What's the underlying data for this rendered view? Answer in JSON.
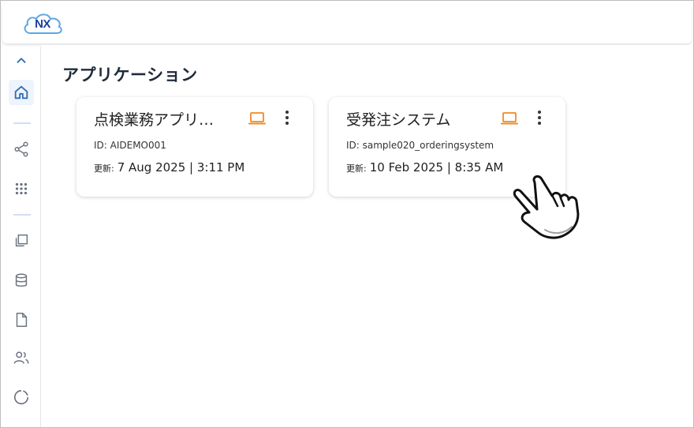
{
  "app": {
    "logo_text": "NX"
  },
  "sidebar": {
    "items": [
      {
        "name": "collapse",
        "icon": "chevron-up-icon"
      },
      {
        "name": "home",
        "icon": "home-icon",
        "active": true
      },
      {
        "name": "share",
        "icon": "share-icon"
      },
      {
        "name": "apps",
        "icon": "grid-icon"
      },
      {
        "name": "copy",
        "icon": "copy-icon"
      },
      {
        "name": "database",
        "icon": "database-icon"
      },
      {
        "name": "document",
        "icon": "document-icon"
      },
      {
        "name": "users",
        "icon": "users-icon"
      },
      {
        "name": "loading",
        "icon": "loading-icon"
      }
    ]
  },
  "main": {
    "title": "アプリケーション",
    "cards": [
      {
        "title": "点検業務アプリ…",
        "id_label": "ID: AIDEMO001",
        "updated_label": "更新:",
        "updated_value": "7 Aug 2025 | 3:11 PM"
      },
      {
        "title": "受発注システム",
        "id_label": "ID: sample020_orderingsystem",
        "updated_label": "更新:",
        "updated_value": "10 Feb 2025 | 8:35 AM"
      }
    ]
  },
  "colors": {
    "accent_orange": "#f08a24",
    "nav_blue": "#2e6db4",
    "icon_gray": "#6b7380",
    "logo_blue": "#1d3f9a"
  }
}
